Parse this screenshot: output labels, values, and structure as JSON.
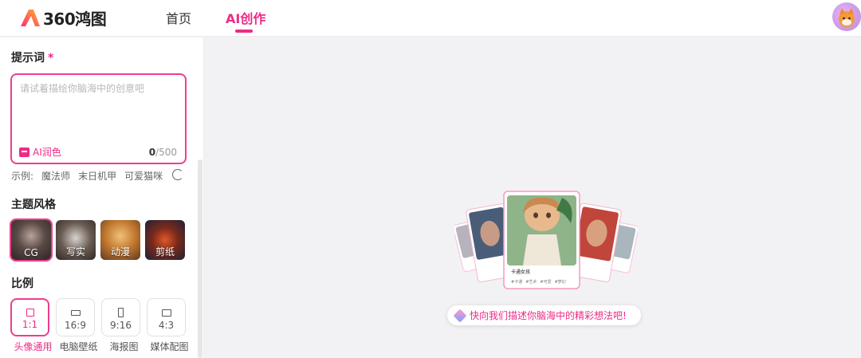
{
  "header": {
    "brand": "360鸿图",
    "nav": [
      {
        "label": "首页"
      },
      {
        "label": "AI创作"
      }
    ]
  },
  "sidebar": {
    "prompt_title": "提示词",
    "required_mark": "*",
    "prompt_placeholder": "请试着描绘你脑海中的创意吧",
    "prompt_value": "",
    "polish_label": "AI润色",
    "count_current": "0",
    "count_max": "/500",
    "examples_label": "示例:",
    "examples": [
      "魔法师",
      "末日机甲",
      "可爱猫咪"
    ],
    "style_title": "主题风格",
    "styles": [
      {
        "label": "CG"
      },
      {
        "label": "写实"
      },
      {
        "label": "动漫"
      },
      {
        "label": "剪纸"
      }
    ],
    "ratio_title": "比例",
    "ratios": [
      {
        "value": "1:1",
        "name": "头像通用"
      },
      {
        "value": "16:9",
        "name": "电脑壁纸"
      },
      {
        "value": "9:16",
        "name": "海报图"
      },
      {
        "value": "4:3",
        "name": "媒体配图"
      }
    ]
  },
  "main": {
    "hint": "快向我们描述你脑海中的精彩想法吧!",
    "card_title": "卡通女孩",
    "card_tags": [
      "#卡通",
      "#艺术",
      "#可爱",
      "#梦幻"
    ]
  },
  "colors": {
    "accent": "#ee2a86"
  }
}
